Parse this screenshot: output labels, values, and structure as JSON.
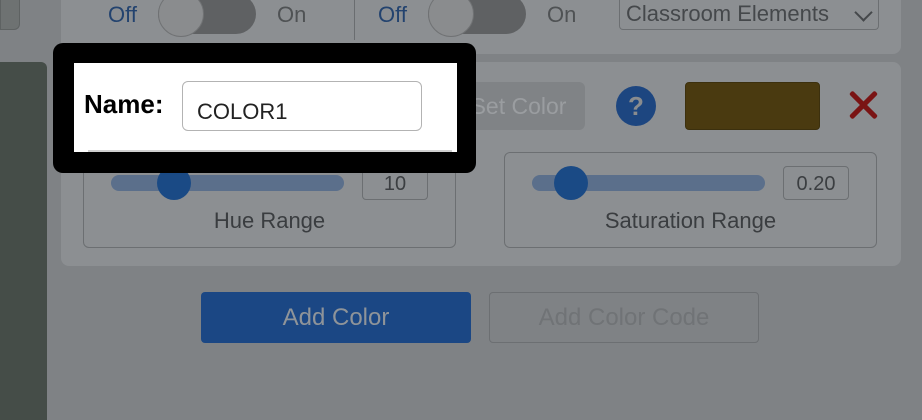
{
  "top_controls": {
    "toggle1": {
      "off_label": "Off",
      "on_label": "On"
    },
    "toggle2": {
      "off_label": "Off",
      "on_label": "On"
    },
    "category_select": {
      "value": "Classroom Elements"
    }
  },
  "color_entry": {
    "name_label": "Name:",
    "name_value": "COLOR1",
    "set_color_label": "Set Color",
    "help_symbol": "?",
    "swatch_color": "#4a3a10",
    "hue_range": {
      "label": "Hue Range",
      "value": "10",
      "fraction": 0.17
    },
    "saturation_range": {
      "label": "Saturation Range",
      "value": "0.20",
      "fraction": 0.17
    }
  },
  "actions": {
    "add_color_label": "Add Color",
    "add_color_code_label": "Add Color Code"
  },
  "colors": {
    "accent": "#005cc8",
    "delete": "#d40000",
    "highlight_frame": "#000000"
  }
}
